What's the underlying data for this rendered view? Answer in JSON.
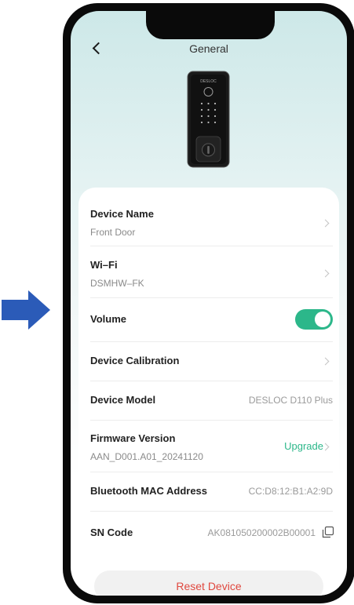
{
  "header": {
    "title": "General"
  },
  "rows": {
    "device_name": {
      "label": "Device Name",
      "value": "Front Door"
    },
    "wifi": {
      "label": "Wi–Fi",
      "value": "DSMHW–FK"
    },
    "volume": {
      "label": "Volume",
      "enabled": true
    },
    "calibration": {
      "label": "Device Calibration"
    },
    "model": {
      "label": "Device Model",
      "value": "DESLOC D110 Plus"
    },
    "firmware": {
      "label": "Firmware Version",
      "value": "AAN_D001.A01_20241120",
      "action": "Upgrade"
    },
    "bluetooth": {
      "label": "Bluetooth MAC Address",
      "value": "CC:D8:12:B1:A2:9D"
    },
    "sn": {
      "label": "SN Code",
      "value": "AK081050200002B00001"
    }
  },
  "reset_label": "Reset Device",
  "device_logo": "DESLOC",
  "colors": {
    "accent": "#2cb78a",
    "danger": "#e0483f",
    "arrow": "#2b5bb8"
  },
  "icons": {
    "back": "chevron-left-icon",
    "chevron": "chevron-right-icon",
    "copy": "copy-icon",
    "arrow": "arrow-right-icon"
  }
}
